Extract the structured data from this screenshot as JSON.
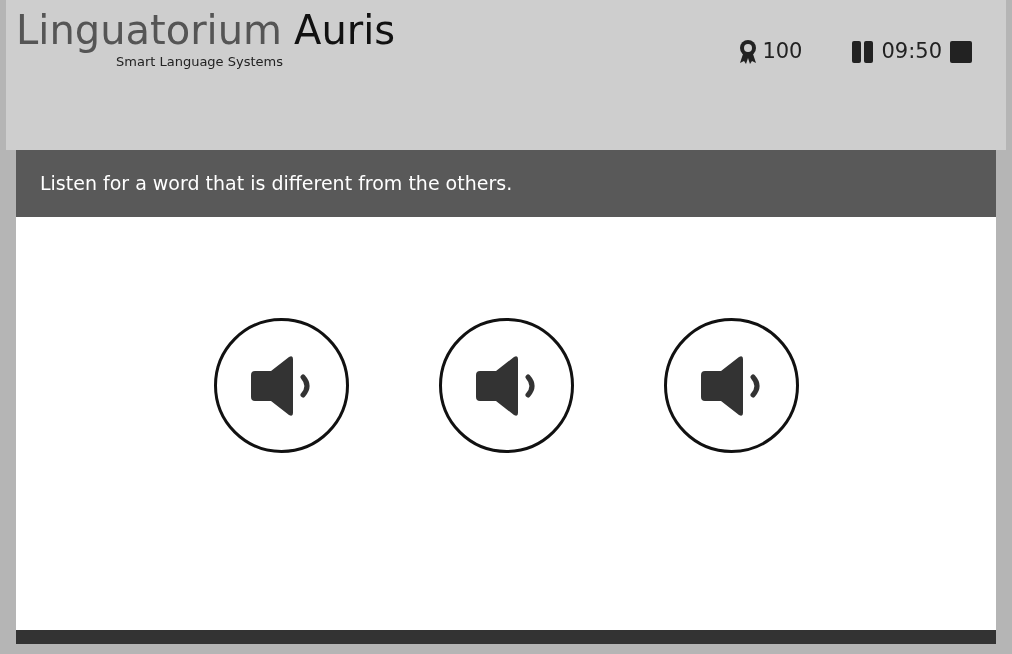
{
  "header": {
    "brand": "Linguatorium",
    "product": "Auris",
    "tagline": "Smart Language Systems",
    "score": "100",
    "timer": "09:50"
  },
  "exercise": {
    "instruction": "Listen for a word that is different from the others.",
    "sound_buttons": [
      {
        "kind": "speaker"
      },
      {
        "kind": "speaker"
      },
      {
        "kind": "speaker"
      }
    ]
  }
}
